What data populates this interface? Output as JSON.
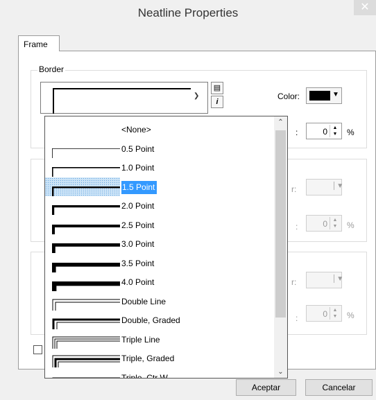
{
  "window": {
    "title": "Neatline Properties",
    "close_glyph": "✕"
  },
  "tabs": [
    {
      "label": "Frame"
    }
  ],
  "border_group": {
    "label": "Border",
    "color_label": "Color:",
    "color_value": "#000000",
    "gap_label": ":",
    "gap_value": "0",
    "gap_unit": "%"
  },
  "background_group": {
    "color_label": "r:",
    "gap_label": ":",
    "gap_value": "0",
    "gap_unit": "%"
  },
  "shadow_group": {
    "color_label": "r:",
    "gap_label": ":",
    "gap_value": "0",
    "gap_unit": "%"
  },
  "border_dropdown": {
    "selected_index": 3,
    "items": [
      {
        "label": "<None>",
        "style": "none"
      },
      {
        "label": "0.5 Point",
        "style": "single",
        "width": 0.5
      },
      {
        "label": "1.0 Point",
        "style": "single",
        "width": 1.0
      },
      {
        "label": "1.5 Point",
        "style": "single",
        "width": 1.5
      },
      {
        "label": "2.0 Point",
        "style": "single",
        "width": 2.0
      },
      {
        "label": "2.5 Point",
        "style": "single",
        "width": 2.5
      },
      {
        "label": "3.0 Point",
        "style": "single",
        "width": 3.0
      },
      {
        "label": "3.5 Point",
        "style": "single",
        "width": 3.5
      },
      {
        "label": "4.0 Point",
        "style": "single",
        "width": 4.0
      },
      {
        "label": "Double Line",
        "style": "double"
      },
      {
        "label": "Double, Graded",
        "style": "double-graded"
      },
      {
        "label": "Triple Line",
        "style": "triple"
      },
      {
        "label": "Triple, Graded",
        "style": "triple-graded"
      },
      {
        "label": "Triple, Ctr W",
        "style": "triple-ctr"
      }
    ]
  },
  "buttons": {
    "ok": "Aceptar",
    "cancel": "Cancelar"
  },
  "colors": {
    "selection": "#3399ff",
    "selection_band": "#cce4f7"
  }
}
